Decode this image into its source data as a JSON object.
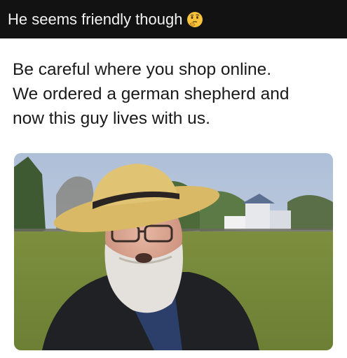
{
  "caption": {
    "text": "He seems friendly though",
    "emoji_icon": "thinking-face-icon"
  },
  "post": {
    "lines": [
      "Be careful where you shop online.",
      "We ordered a german shepherd and",
      "now this guy lives with us."
    ]
  },
  "photo": {
    "subject": "man-with-straw-hat-and-white-beard-photo"
  }
}
